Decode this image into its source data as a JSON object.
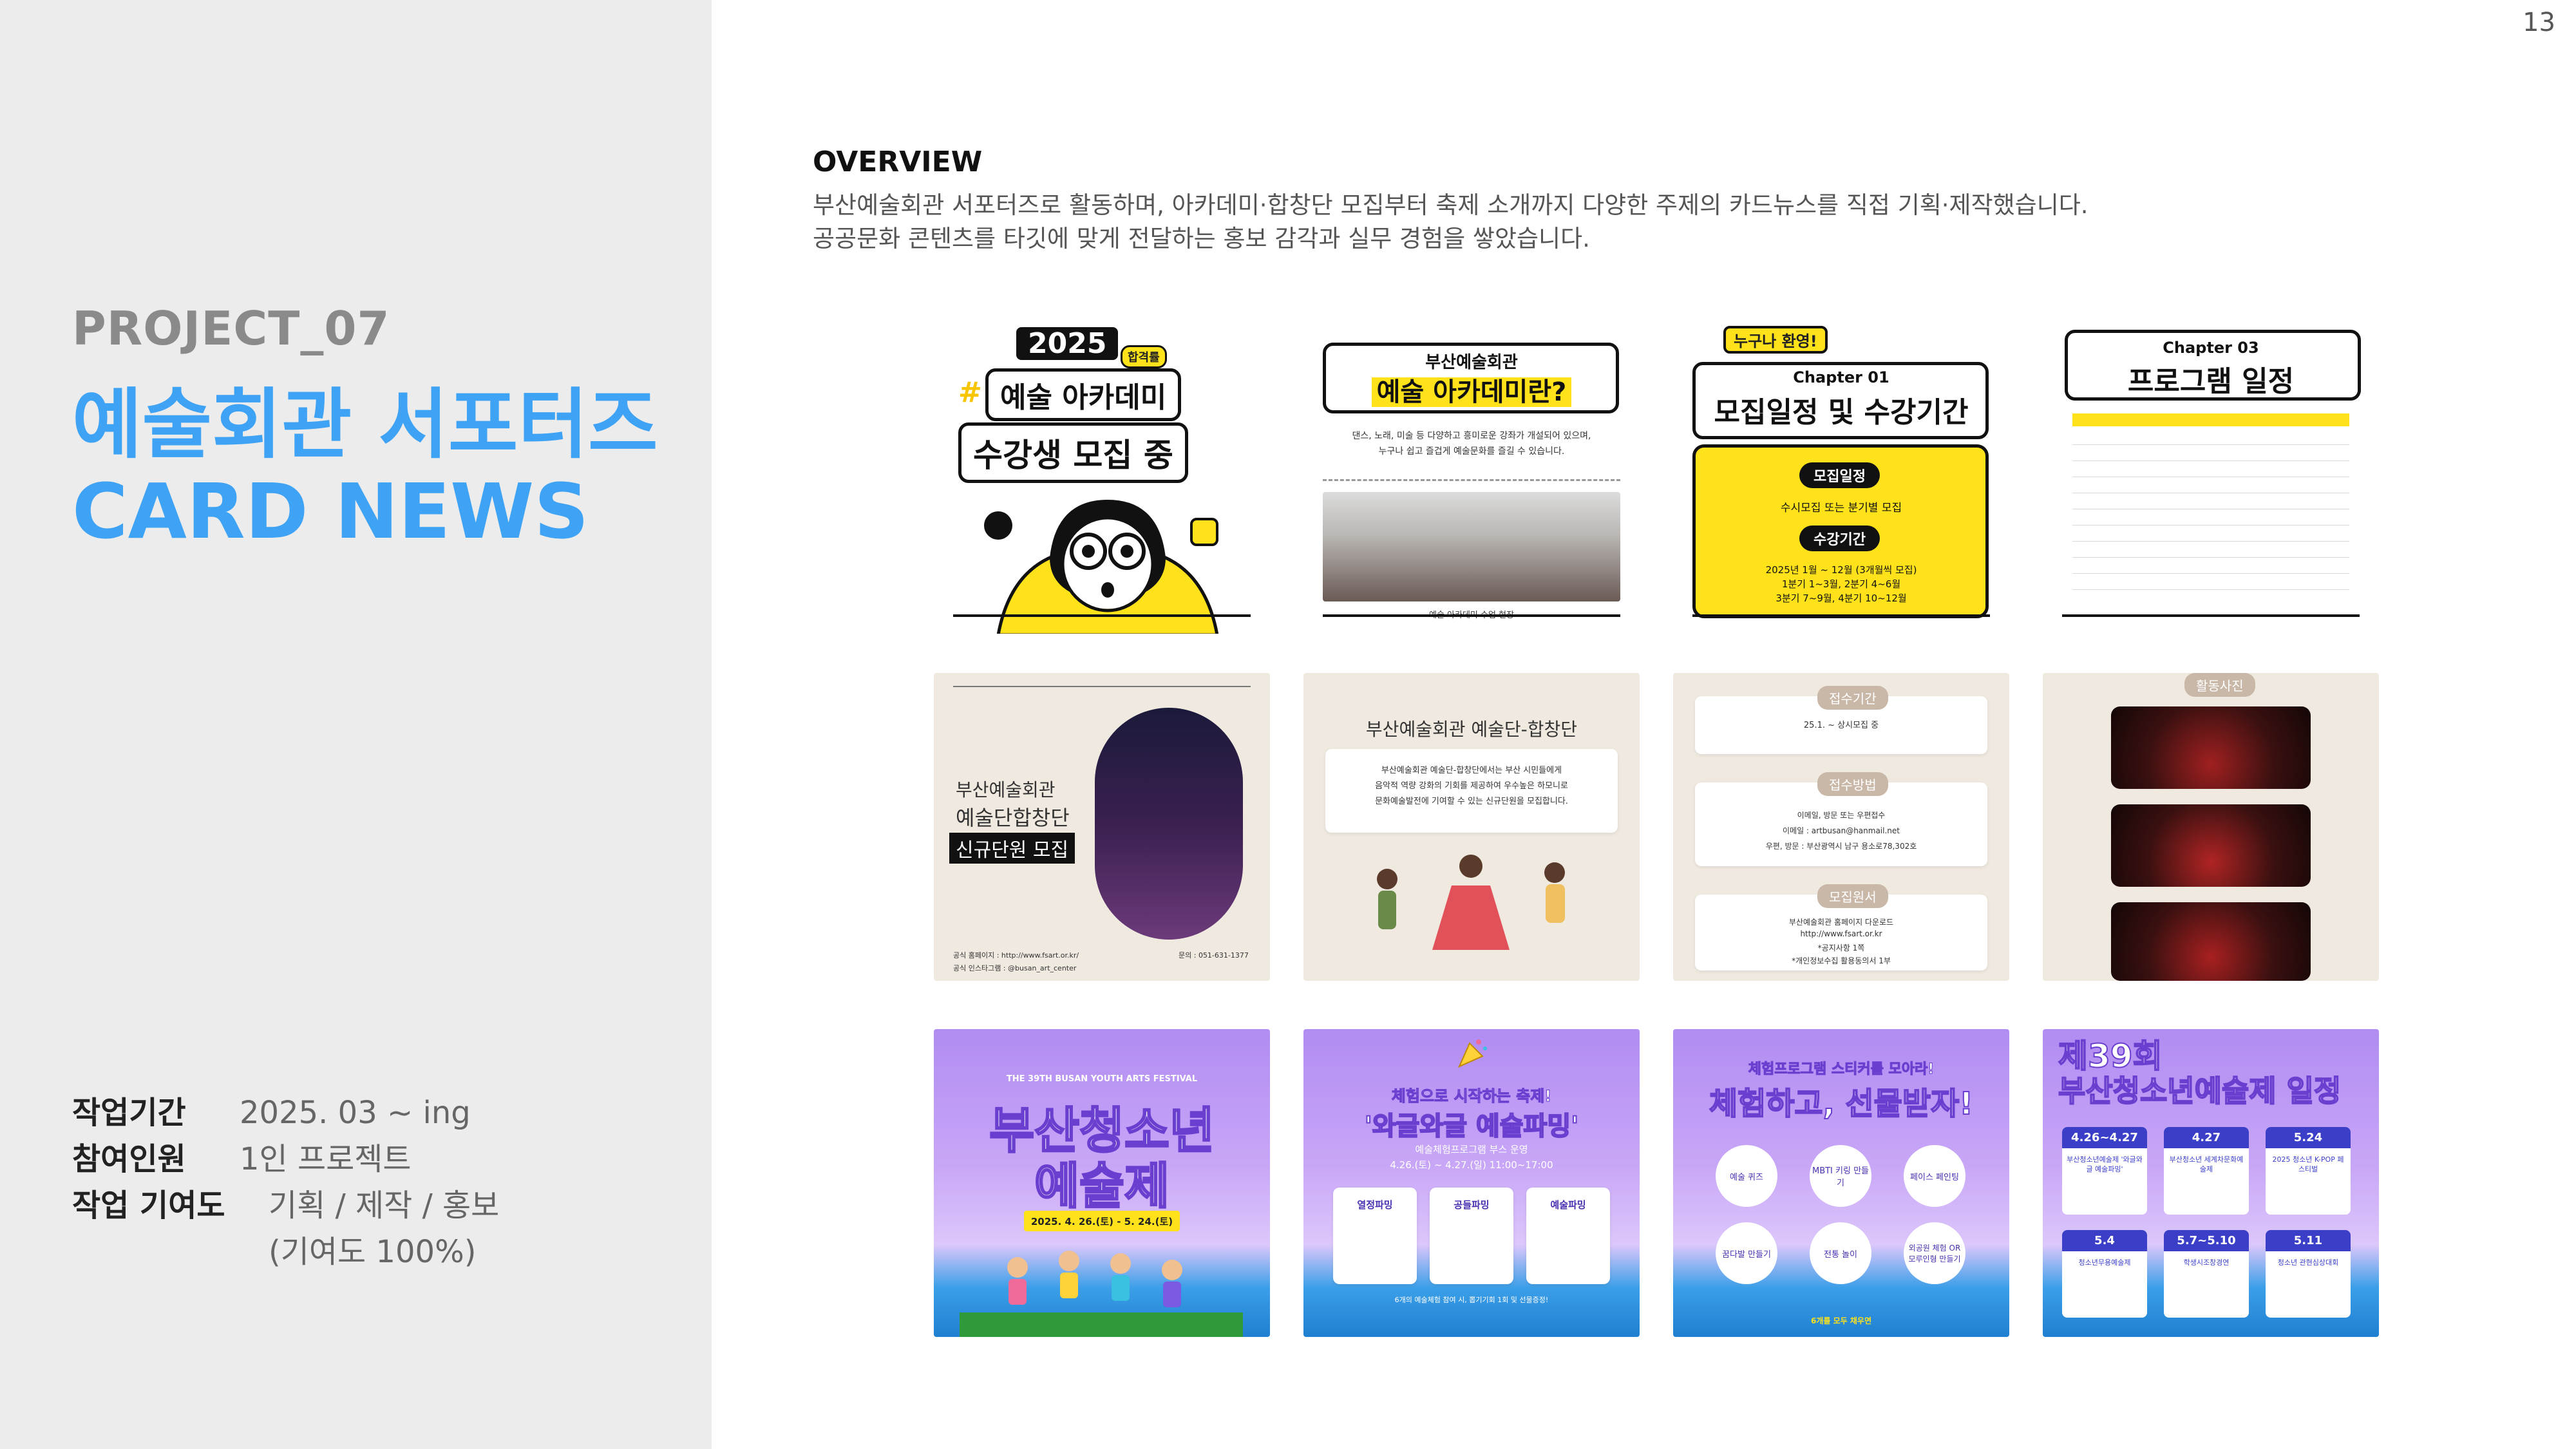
{
  "page_number": "13",
  "sidebar": {
    "project_label": "PROJECT_07",
    "title_line1": "예술회관 서포터즈",
    "title_line2": "CARD NEWS",
    "meta": [
      {
        "key": "작업기간",
        "value": "2025. 03 ~ ing"
      },
      {
        "key": "참여인원",
        "value": "1인 프로젝트"
      },
      {
        "key": "작업 기여도",
        "value": "기획 / 제작 / 홍보"
      }
    ],
    "contribution_note": "(기여도 100%)"
  },
  "overview": {
    "heading": "OVERVIEW",
    "line1": "부산예술회관 서포터즈로 활동하며, 아카데미·합창단 모집부터 축제 소개까지 다양한 주제의 카드뉴스를 직접 기획·제작했습니다.",
    "line2": "공공문화 콘텐츠를 타깃에 맞게 전달하는 홍보 감각과 실무 경험을 쌓았습니다."
  },
  "cards": {
    "academy": {
      "c1": {
        "year": "2025",
        "badge": "합격률",
        "hash": "#",
        "line1": "예술 아카데미",
        "line2": "수강생 모집 중"
      },
      "c2": {
        "top": "부산예술회관",
        "title": "예술 아카데미란?",
        "body1": "댄스, 노래, 미술 등 다양하고 흥미로운 강좌가 개설되어 있으며,",
        "body2": "누구나 쉽고 즐겁게 예술문화를 즐길 수 있습니다.",
        "caption": "예술 아카데미 수업 현장"
      },
      "c3": {
        "badge": "누구나 환영!",
        "chapter": "Chapter 01",
        "title": "모집일정 및 수강기간",
        "pill1": "모집일정",
        "text1": "수시모집 또는 분기별 모집",
        "pill2": "수강기간",
        "text2a": "2025년 1월 ~ 12월 (3개월씩 모집)",
        "text2b": "1분기 1~3월, 2분기 4~6월",
        "text2c": "3분기 7~9월, 4분기 10~12월"
      },
      "c4": {
        "chapter": "Chapter 03",
        "title": "프로그램 일정"
      }
    },
    "choir": {
      "c1": {
        "line1": "부산예술회관",
        "line2": "예술단합창단",
        "line3": "신규단원 모집",
        "footer1": "공식 홈페이지 : http://www.fsart.or.kr/",
        "footer2": "공식 인스타그램 : @busan_art_center",
        "footer3": "문의 : 051-631-1377"
      },
      "c2": {
        "title": "부산예술회관 예술단-합창단",
        "body1": "부산예술회관 예술단-합창단에서는 부산 시민들에게",
        "body2": "음악적 역량 강화의 기회를 제공하여 우수높은 하모니로",
        "body3": "문화예술발전에 기여할 수 있는 신규단원을 모집합니다."
      },
      "c3": {
        "tag1": "접수기간",
        "text1": "25.1. ~ 상시모집 중",
        "tag2": "접수방법",
        "text2a": "이메일, 방문 또는 우편접수",
        "text2b": "이메일 : artbusan@hanmail.net",
        "text2c": "우편, 방문 : 부산광역시 남구 용소로78,302호",
        "tag3": "모집원서",
        "text3a": "부산예술회관 홈페이지 다운로드",
        "text3b": "http://www.fsart.or.kr",
        "text3c": "*공지사항 1쪽",
        "text3d": "*개인정보수집 활용동의서 1부"
      },
      "c4": {
        "tag": "활동사진"
      }
    },
    "festival": {
      "c1": {
        "subtitle": "THE 39TH BUSAN YOUTH ARTS FESTIVAL",
        "line1": "부산청소년",
        "line2": "예술제",
        "dates": "2025. 4. 26.(토) - 5. 24.(토)"
      },
      "c2": {
        "line1": "체험으로 시작하는 축제!",
        "line2": "'와글와글 예술파밍'",
        "sub1": "예술체험프로그램 부스 운영",
        "sub2": "4.26.(토) ~ 4.27.(일) 11:00~17:00",
        "col1": "열정파밍",
        "col2": "공들파밍",
        "col3": "예술파밍",
        "foot": "6개의 예술체험 참여 시, 뽑기기회 1회 및 선물증정!"
      },
      "c3": {
        "line1": "체험프로그램 스티커를 모아라!",
        "line2": "체험하고, 선물받자!",
        "circles": [
          "예술 퀴즈",
          "MBTI 키링 만들기",
          "페이스 페인팅",
          "꿈다발 만들기",
          "전통 놀이",
          "외공원 체험 OR 모루인형 만들기"
        ],
        "foot": "6개를 모두 채우면"
      },
      "c4": {
        "title1": "제39회",
        "title2": "부산청소년예술제 일정",
        "boxes": [
          {
            "date": "4.26~4.27",
            "text": "부산청소년예술제 '와글와글 예술파밍'"
          },
          {
            "date": "4.27",
            "text": "부산청소년 세계차문화예술제"
          },
          {
            "date": "5.24",
            "text": "2025 청소년 K-POP 페스티벌"
          },
          {
            "date": "5.4",
            "text": "청소년무용예술제"
          },
          {
            "date": "5.7~5.10",
            "text": "학생시조창경연"
          },
          {
            "date": "5.11",
            "text": "청소년 관현심상대회"
          }
        ]
      }
    }
  }
}
